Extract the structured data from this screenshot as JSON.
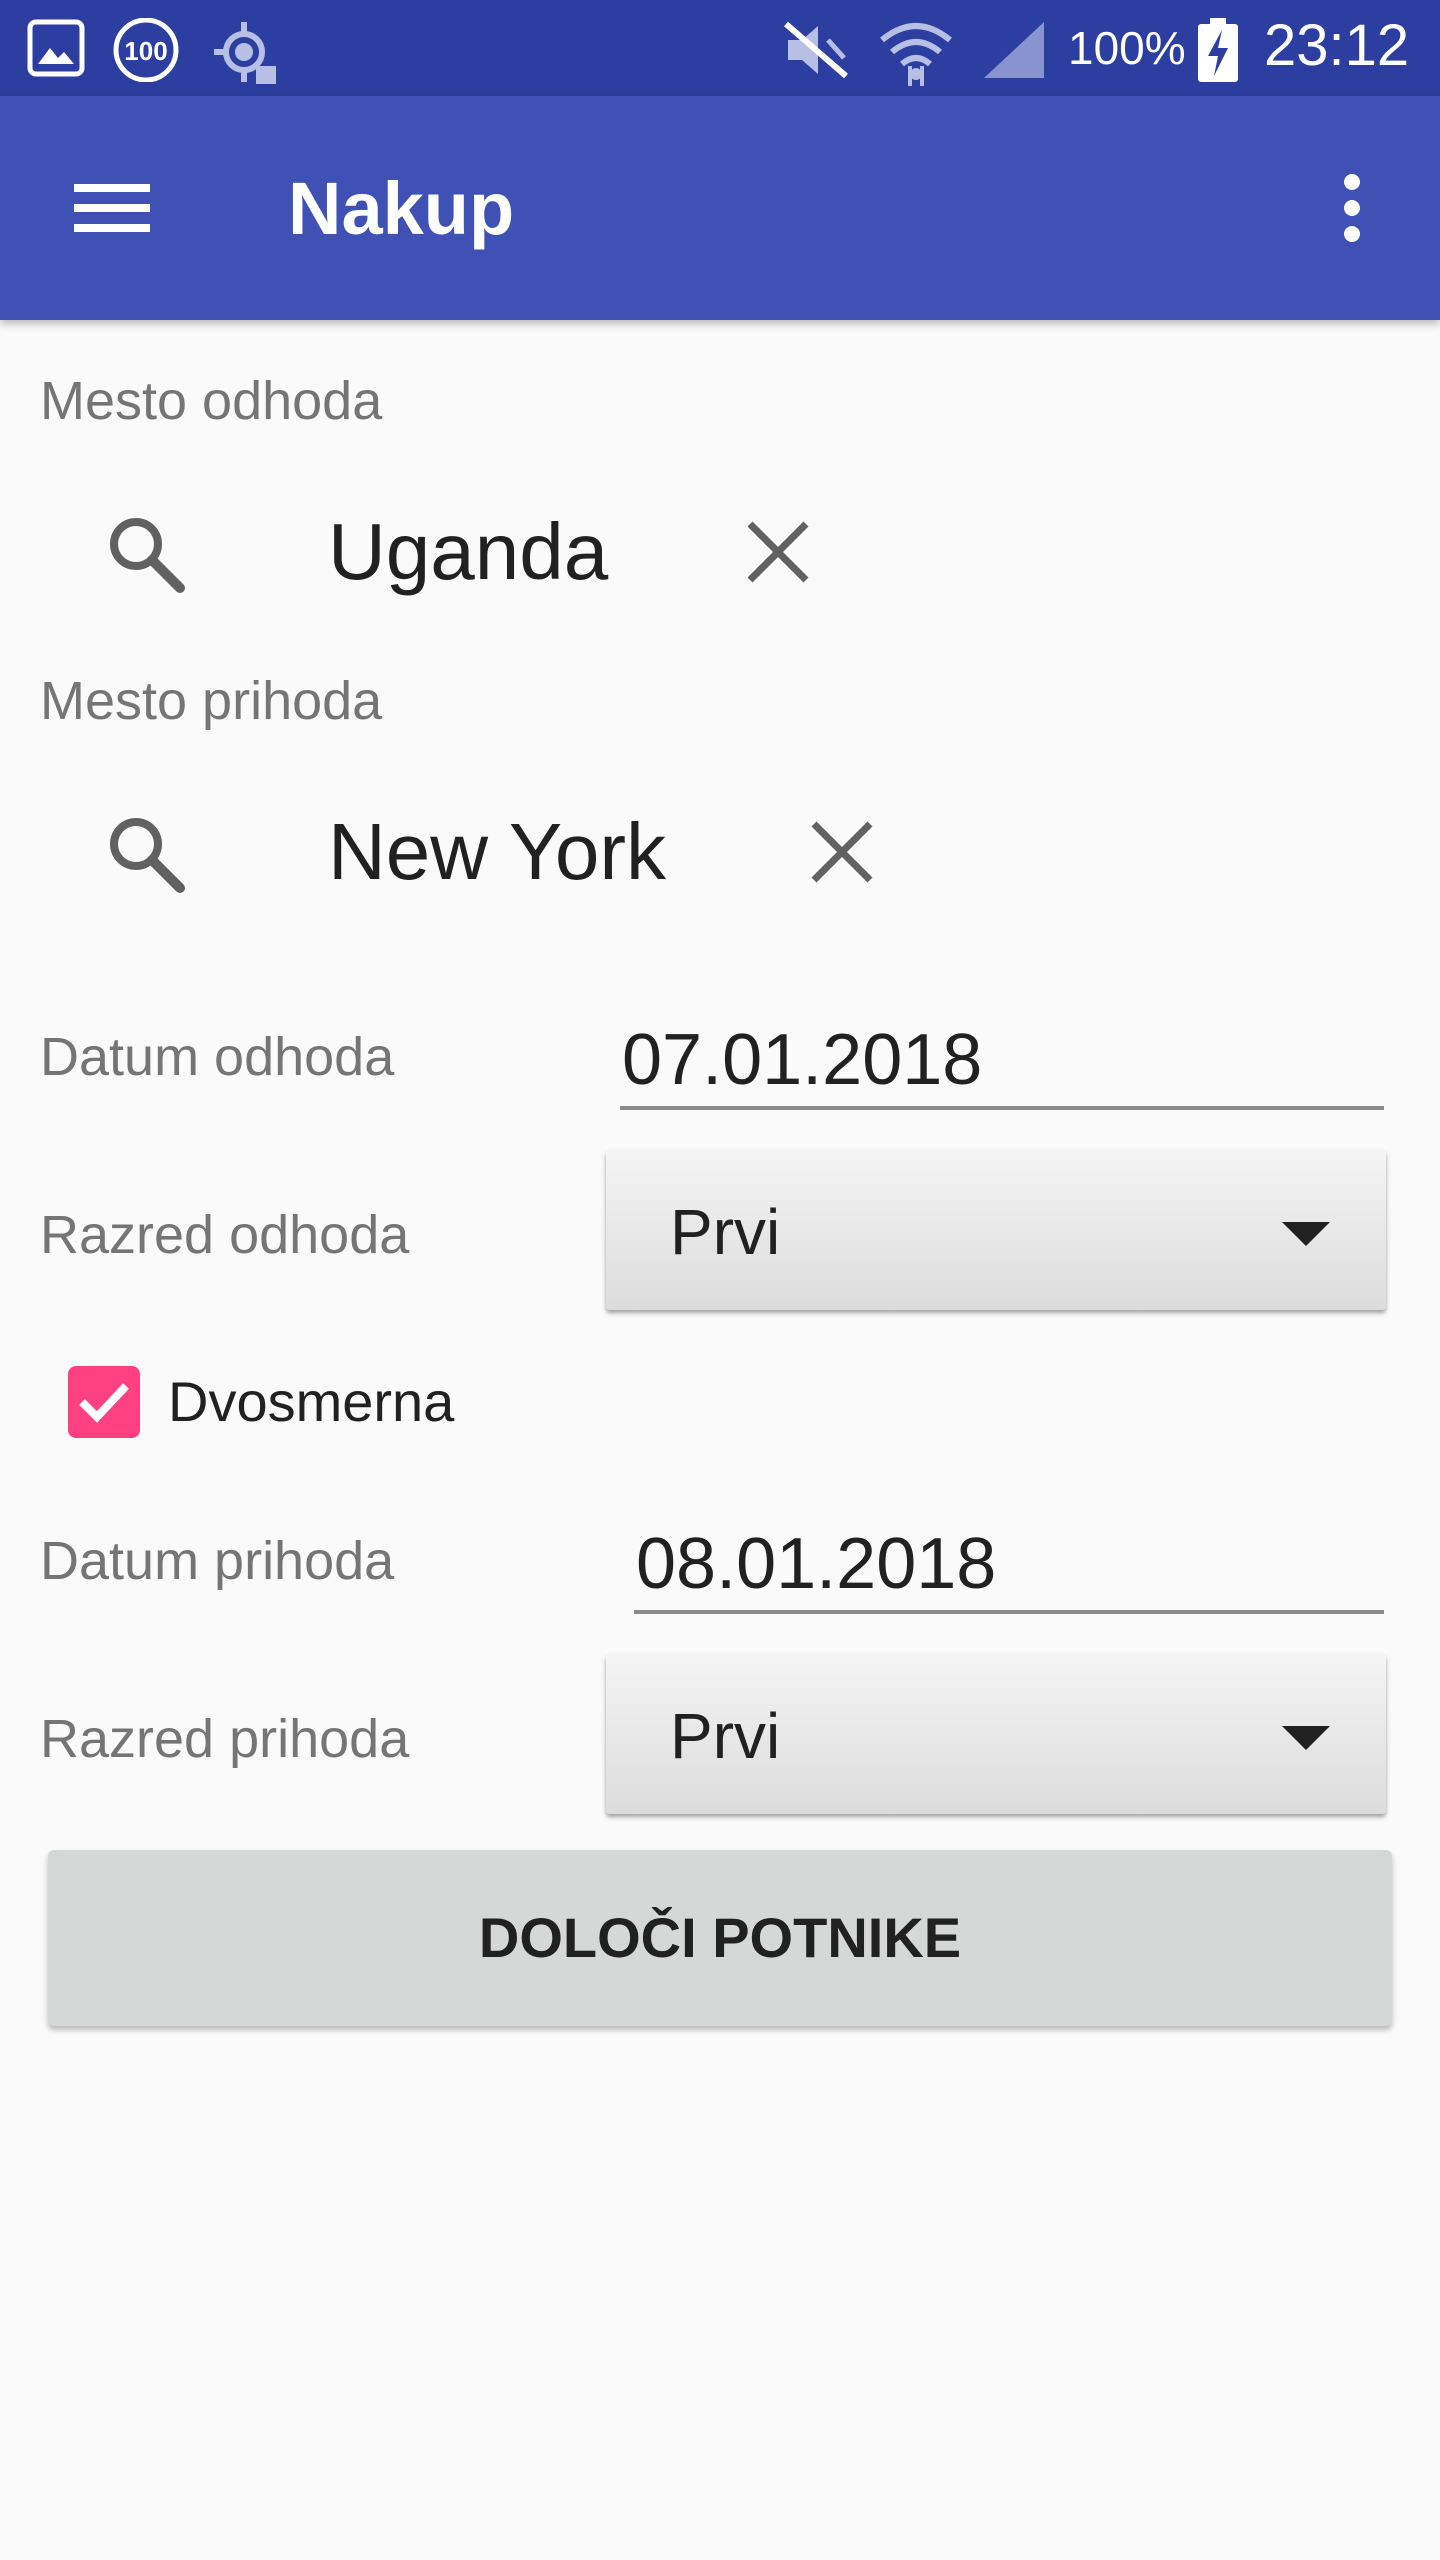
{
  "status_bar": {
    "battery_percent": "100%",
    "time": "23:12",
    "icons": [
      "gallery-icon",
      "100-badge-icon",
      "location-target-icon",
      "mute-icon",
      "wifi-icon",
      "signal-icon",
      "battery-charging-icon"
    ]
  },
  "app_bar": {
    "title": "Nakup",
    "menu_icon": "hamburger-menu-icon",
    "overflow_icon": "more-vert-icon",
    "background": "#3f51b5"
  },
  "departure_place": {
    "label": "Mesto odhoda",
    "value": "Uganda"
  },
  "arrival_place": {
    "label": "Mesto prihoda",
    "value": "New York"
  },
  "departure_date": {
    "label": "Datum odhoda",
    "value": "07.01.2018"
  },
  "departure_class": {
    "label": "Razred odhoda",
    "value": "Prvi"
  },
  "round_trip": {
    "label": "Dvosmerna",
    "checked": true,
    "color": "#ff4081"
  },
  "arrival_date": {
    "label": "Datum prihoda",
    "value": "08.01.2018"
  },
  "arrival_class": {
    "label": "Razred prihoda",
    "value": "Prvi"
  },
  "action_button": {
    "label": "DOLOČI POTNIKE"
  }
}
